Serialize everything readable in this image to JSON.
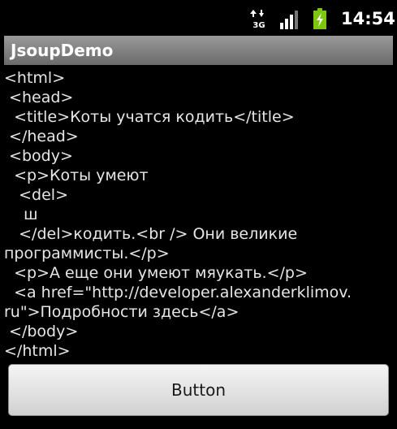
{
  "status_bar": {
    "network_type": "3G",
    "time": "14:54",
    "icons": [
      "network-3g-icon",
      "signal-icon",
      "battery-charging-icon"
    ],
    "battery_color": "#7dc70f"
  },
  "app": {
    "title": "JsoupDemo",
    "title_bar_color": "#808080"
  },
  "content": {
    "lines": [
      "<html>",
      " <head>",
      "  <title>Коты учатся кодить</title>",
      " </head>",
      " <body>",
      "  <p>Коты умеют",
      "   <del>",
      "    ш",
      "   </del>кодить.<br /> Они великие",
      "программисты.</p>",
      "  <p>А еще они умеют мяукать.</p>",
      "  <a href=\"http://developer.alexanderklimov.",
      "ru\">Подробности здесь</a>",
      " </body>",
      "</html>"
    ]
  },
  "button": {
    "label": "Button"
  }
}
